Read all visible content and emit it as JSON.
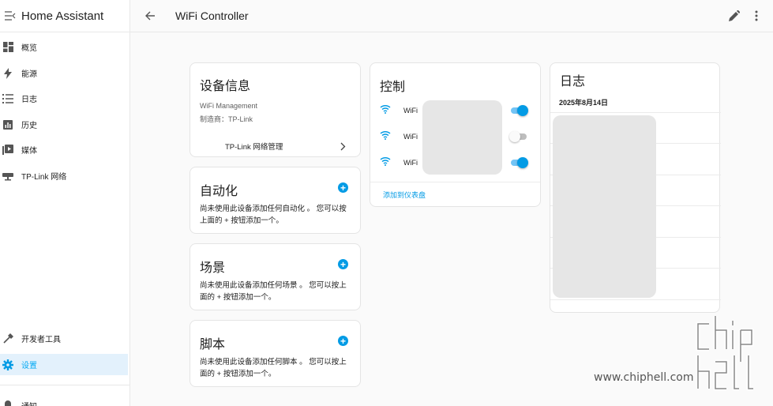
{
  "sidebar": {
    "title": "Home Assistant",
    "items": [
      {
        "label": "概览",
        "icon": "dashboard-icon"
      },
      {
        "label": "能源",
        "icon": "lightning-icon"
      },
      {
        "label": "日志",
        "icon": "list-icon"
      },
      {
        "label": "历史",
        "icon": "chart-icon"
      },
      {
        "label": "媒体",
        "icon": "media-icon"
      },
      {
        "label": "TP-Link 网络",
        "icon": "router-icon"
      }
    ],
    "bottom_items": [
      {
        "label": "开发者工具",
        "icon": "hammer-icon"
      },
      {
        "label": "设置",
        "icon": "gear-icon"
      },
      {
        "label": "通知",
        "icon": "bell-icon"
      }
    ]
  },
  "topbar": {
    "title": "WiFi Controller"
  },
  "device_info": {
    "title": "设备信息",
    "model": "WiFi Management",
    "manufacturer": "制造商：TP-Link",
    "link": "TP-Link 网络管理"
  },
  "automation": {
    "title": "自动化",
    "desc_line1": "尚未使用此设备添加任何自动化 。 您可以按",
    "desc_line2": "上面的 + 按钮添加一个。"
  },
  "scene": {
    "title": "场景",
    "desc_line1": "尚未使用此设备添加任何场景 。 您可以按上",
    "desc_line2": "面的 + 按钮添加一个。"
  },
  "script": {
    "title": "脚本",
    "desc_line1": "尚未使用此设备添加任何脚本 。 您可以按上",
    "desc_line2": "面的 + 按钮添加一个。"
  },
  "controls": {
    "title": "控制",
    "rows": [
      {
        "label": "WiFi",
        "state": "on"
      },
      {
        "label": "WiFi",
        "state": "off"
      },
      {
        "label": "WiFi",
        "state": "on"
      }
    ],
    "add_to_dashboard": "添加到仪表盘"
  },
  "logbook": {
    "title": "日志",
    "date": "2025年8月14日"
  },
  "watermark": {
    "site": "www.chiphell.com"
  },
  "colors": {
    "accent": "#039be5",
    "active_bg": "#e3f1fc"
  }
}
